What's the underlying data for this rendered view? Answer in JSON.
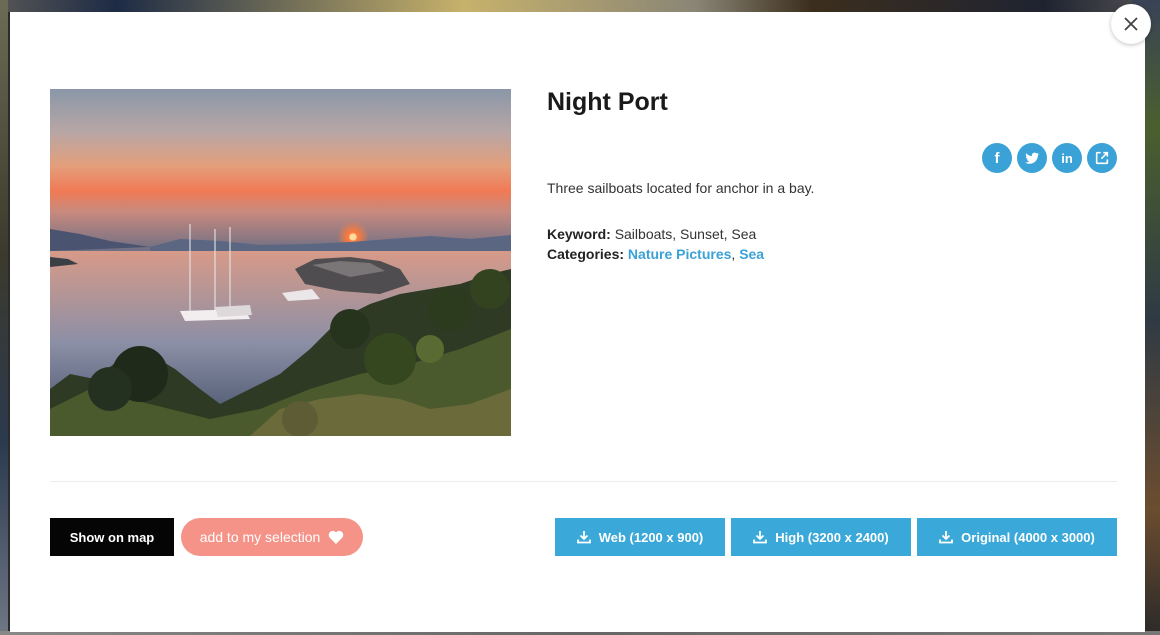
{
  "modal": {
    "title": "Night Port",
    "description": "Three sailboats located for anchor in a bay.",
    "keyword_label": "Keyword:",
    "keyword_value": "Sailboats, Sunset, Sea",
    "categories_label": "Categories:",
    "categories": [
      "Nature Pictures",
      "Sea"
    ],
    "category_separator": ",",
    "image_icon": "photo-sunset-sailboats"
  },
  "share": {
    "icons": [
      "facebook-icon",
      "twitter-icon",
      "linkedin-icon",
      "external-link-icon"
    ],
    "facebook_glyph": "f",
    "linkedin_glyph": "in"
  },
  "actions": {
    "show_on_map": "Show on map",
    "add_selection": "add to my selection",
    "download_web": "Web (1200 x 900)",
    "download_high": "High (3200 x 2400)",
    "download_original": "Original (4000 x 3000)"
  },
  "colors": {
    "accent": "#3aa2d6",
    "download": "#3aa8d8",
    "selection": "#f59388",
    "map_button": "#050505"
  }
}
